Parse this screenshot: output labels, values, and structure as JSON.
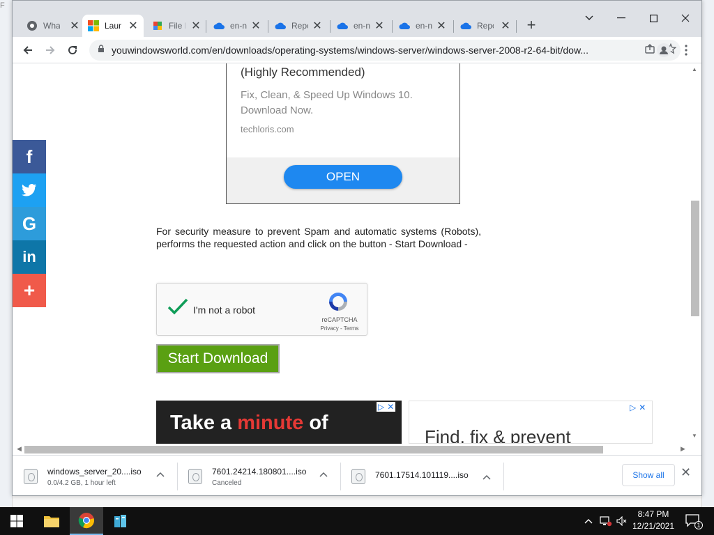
{
  "background_app": {
    "title": "F"
  },
  "browser": {
    "tabs": [
      {
        "title": "Wha",
        "icon": "chrome-icon",
        "active": false
      },
      {
        "title": "Laun",
        "icon": "microsoft-logo-icon",
        "active": true
      },
      {
        "title": "File I",
        "icon": "file-icon",
        "active": false
      },
      {
        "title": "en-n",
        "icon": "cloud-icon",
        "active": false
      },
      {
        "title": "Repo",
        "icon": "cloud-icon",
        "active": false
      },
      {
        "title": "en-n",
        "icon": "cloud-icon",
        "active": false
      },
      {
        "title": "en-n",
        "icon": "cloud-icon",
        "active": false
      },
      {
        "title": "Repo",
        "icon": "cloud-icon",
        "active": false
      }
    ],
    "url": "youwindowsworld.com/en/downloads/operating-systems/windows-server/windows-server-2008-r2-64-bit/dow..."
  },
  "page": {
    "ad_top": {
      "headline": "(Highly Recommended)",
      "description": "Fix, Clean, & Speed Up Windows 10. Download Now.",
      "source": "techloris.com",
      "button": "OPEN"
    },
    "instructions": "For security measure to prevent Spam and automatic systems (Robots), performs the requested action and click on the button - Start Download -",
    "captcha": {
      "label": "I'm not a robot",
      "brand": "reCAPTCHA",
      "links": "Privacy - Terms"
    },
    "start_download": "Start Download",
    "ad_bottom_left": {
      "text_before": "Take a ",
      "highlight": "minute",
      "text_after": " of"
    },
    "ad_bottom_right": {
      "text": "Find, fix & prevent"
    },
    "social": [
      {
        "name": "facebook",
        "glyph": "f",
        "color": "#3b5998"
      },
      {
        "name": "twitter",
        "glyph": "🐦",
        "color": "#1da1f2"
      },
      {
        "name": "google",
        "glyph": "G",
        "color": "#2d9cdb"
      },
      {
        "name": "linkedin",
        "glyph": "in",
        "color": "#0e76a8"
      },
      {
        "name": "more",
        "glyph": "+",
        "color": "#f05a4a"
      }
    ]
  },
  "downloads": [
    {
      "name": "windows_server_20....iso",
      "status": "0.0/4.2 GB, 1 hour left"
    },
    {
      "name": "7601.24214.180801....iso",
      "status": "Canceled"
    },
    {
      "name": "7601.17514.101119....iso",
      "status": ""
    }
  ],
  "download_bar": {
    "show_all": "Show all"
  },
  "taskbar": {
    "time": "8:47 PM",
    "date": "12/21/2021",
    "notification_count": "1"
  }
}
